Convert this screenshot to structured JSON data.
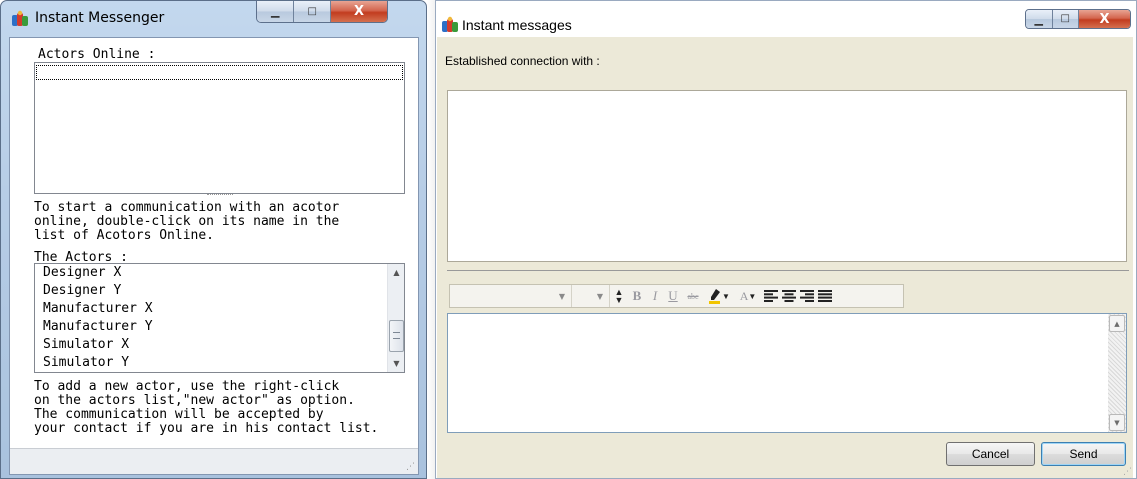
{
  "messenger": {
    "title": "Instant Messenger",
    "online_label": "Actors Online :",
    "online_hint": "To start a communication with an acotor\nonline, double-click on its name in the\nlist of Acotors Online.",
    "actors_label": "The Actors :",
    "actors": [
      "Designer X",
      "Designer Y",
      "Manufacturer X",
      "Manufacturer Y",
      "Simulator X",
      "Simulator Y"
    ],
    "add_hint": "To add a new actor, use the right-click\non the actors list,\"new actor\" as option.\nThe communication will be accepted by\nyour contact if you are in his contact list."
  },
  "messages": {
    "title": "Instant messages",
    "connection_label": "Established connection with :",
    "cancel_label": "Cancel",
    "send_label": "Send"
  },
  "icons": {
    "app": "messenger-app-icon",
    "minimize": "minimize-icon",
    "maximize": "maximize-icon",
    "close": "close-icon"
  },
  "colors": {
    "close_button": "#c23c1f",
    "highlight_underline": "#f2c500",
    "dialog_background": "#ece9d8"
  }
}
